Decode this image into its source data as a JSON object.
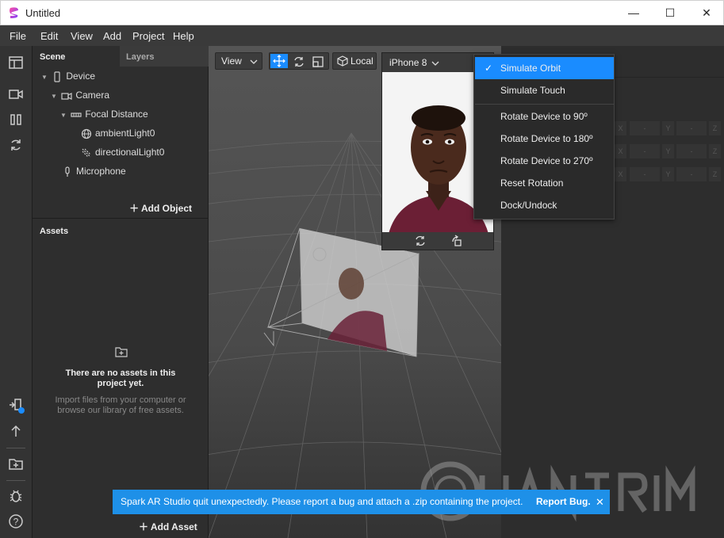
{
  "window": {
    "title": "Untitled",
    "minimize": "—",
    "maximize": "☐",
    "close": "✕"
  },
  "menu": [
    "File",
    "Edit",
    "View",
    "Add",
    "Project",
    "Help"
  ],
  "scene_panel": {
    "tabs": [
      "Scene",
      "Layers"
    ],
    "tree": [
      {
        "label": "Device",
        "icon": "device-icon"
      },
      {
        "label": "Camera",
        "icon": "camera-icon"
      },
      {
        "label": "Focal Distance",
        "icon": "focal-distance-icon"
      },
      {
        "label": "ambientLight0",
        "icon": "ambient-light-icon"
      },
      {
        "label": "directionalLight0",
        "icon": "directional-light-icon"
      },
      {
        "label": "Microphone",
        "icon": "microphone-icon"
      }
    ],
    "add_object": "Add Object"
  },
  "assets_panel": {
    "title": "Assets",
    "empty_title": "There are no assets in this project yet.",
    "empty_sub": "Import files from your computer or browse our library of free assets.",
    "add_asset": "Add Asset"
  },
  "viewport_toolbar": {
    "view": "View",
    "space": "Local"
  },
  "preview": {
    "device": "iPhone 8"
  },
  "dropdown": {
    "items": [
      {
        "label": "Simulate Orbit",
        "checked": true
      },
      {
        "label": "Simulate Touch"
      },
      {
        "label": "Rotate Device to 90º"
      },
      {
        "label": "Rotate Device to 180º"
      },
      {
        "label": "Rotate Device to 270º"
      },
      {
        "label": "Reset Rotation"
      },
      {
        "label": "Dock/Undock"
      }
    ],
    "check": "✓"
  },
  "inspector": {
    "axis_labels": [
      "X",
      "Y",
      "Z"
    ],
    "axis_value": "-"
  },
  "toast": {
    "message": "Spark AR Studio quit unexpectedly. Please report a bug and attach a .zip containing the project.",
    "report": "Report Bug.",
    "close": "✕"
  },
  "colors": {
    "accent": "#1a8cff",
    "toast": "#1e90e8",
    "panel": "#2e2e2e",
    "viewport": "#535353"
  }
}
